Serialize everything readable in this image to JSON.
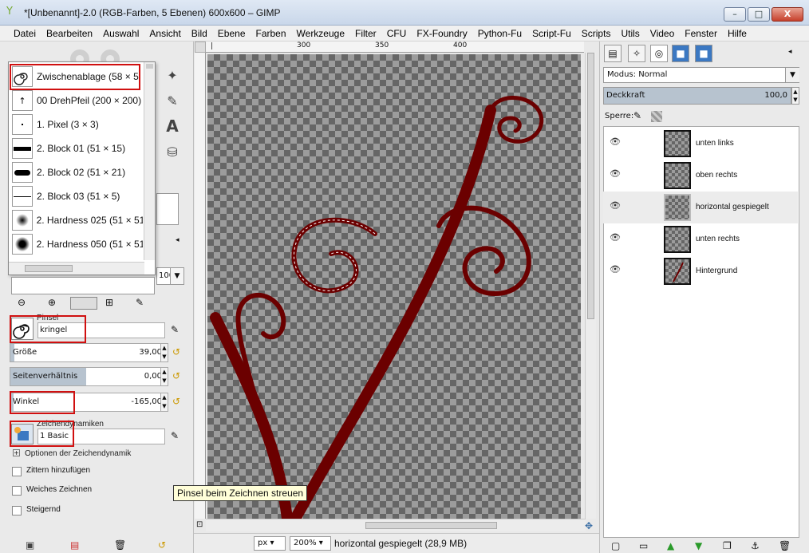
{
  "window": {
    "title": "*[Unbenannt]-2.0 (RGB-Farben, 5 Ebenen) 600x600 – GIMP",
    "min_label": "–",
    "max_label": "□",
    "close_label": "X"
  },
  "menu": [
    "Datei",
    "Bearbeiten",
    "Auswahl",
    "Ansicht",
    "Bild",
    "Ebene",
    "Farben",
    "Werkzeuge",
    "Filter",
    "CFU",
    "FX-Foundry",
    "Python-Fu",
    "Script-Fu",
    "Scripts",
    "Utils",
    "Video",
    "Fenster",
    "Hilfe"
  ],
  "brushes": [
    {
      "label": "Zwischenablage (58 × 5"
    },
    {
      "label": "00 DrehPfeil (200 × 200)"
    },
    {
      "label": "1. Pixel (3 × 3)"
    },
    {
      "label": "2. Block 01 (51 × 15)"
    },
    {
      "label": "2. Block 02 (51 × 21)"
    },
    {
      "label": "2. Block 03 (51 × 5)"
    },
    {
      "label": "2. Hardness 025 (51 × 51"
    },
    {
      "label": "2. Hardness 050 (51 × 51"
    }
  ],
  "tool_options": {
    "opacity_value": "100,0",
    "brush_section_label": "Pinsel",
    "brush_name": "kringel",
    "size": {
      "label": "Größe",
      "value": "39,00"
    },
    "aspect": {
      "label": "Seitenverhältnis",
      "value": "0,00"
    },
    "angle": {
      "label": "Winkel",
      "value": "-165,00"
    },
    "dynamics_label": "Zeichendynamiken",
    "dynamics_value": "1 Basic",
    "dyn_options": "Optionen der Zeichendynamik",
    "checkboxes": [
      "Zittern hinzufügen",
      "Weiches Zeichnen",
      "Steigernd"
    ]
  },
  "tooltip": "Pinsel beim Zeichnen streuen",
  "ruler": {
    "t300": "300",
    "t350": "350",
    "t400": "400"
  },
  "status": {
    "unit": "px",
    "zoom": "200%",
    "message": "horizontal gespiegelt (28,9 MB)"
  },
  "layers_panel": {
    "mode_label": "Modus: Normal",
    "opacity_label": "Deckkraft",
    "opacity_value": "100,0",
    "lock_label": "Sperre:",
    "layers": [
      {
        "name": "unten links"
      },
      {
        "name": "oben rechts"
      },
      {
        "name": "horizontal gespiegelt"
      },
      {
        "name": "unten rechts"
      },
      {
        "name": "Hintergrund"
      }
    ]
  },
  "colors": {
    "accent_red": "#d01010",
    "swirl": "#6b0000"
  }
}
